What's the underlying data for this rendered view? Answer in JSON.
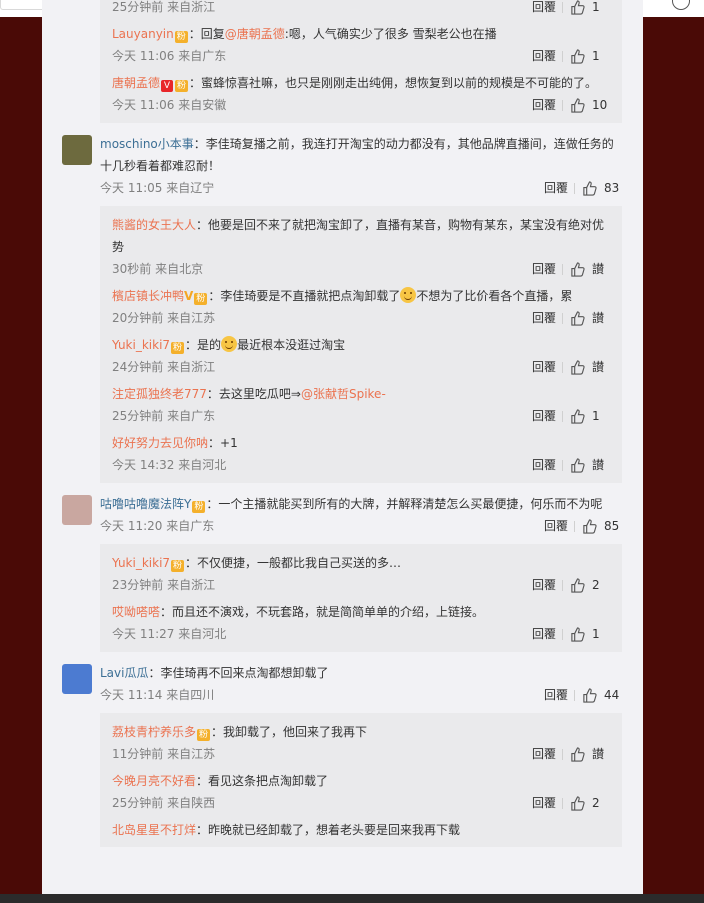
{
  "topbar": {},
  "comments": [
    {
      "user": null,
      "top_partial": true,
      "replies": [
        {
          "name": "",
          "text": "……",
          "time": "25分钟前 来自浙江",
          "reply": "回覆",
          "likes": "1",
          "partial": true
        },
        {
          "name": "Lauyanyin",
          "badge": true,
          "text_prefix": "：回复",
          "at": "@唐朝孟德",
          "text": ":嗯，人气确实少了很多 雪梨老公也在播",
          "time": "今天 11:06 来自广东",
          "reply": "回覆",
          "likes": "1"
        },
        {
          "name": "唐朝孟德",
          "vip": true,
          "badge": true,
          "text": "：蜜蜂惊喜社嘛，也只是刚刚走出纯佣，想恢复到以前的规模是不可能的了。",
          "time": "今天 11:06 来自安徽",
          "reply": "回覆",
          "likes": "10"
        }
      ]
    },
    {
      "user": "moschino小本事",
      "text": "：李佳琦复播之前，我连打开淘宝的动力都没有，其他品牌直播间，连做任务的十几秒看着都难忍耐！",
      "time": "今天 11:05 来自辽宁",
      "reply": "回覆",
      "likes": "83",
      "replies": [
        {
          "name": "熊酱的女王大人",
          "text": "：他要是回不来了就把淘宝卸了，直播有某音，购物有某东，某宝没有绝对优势",
          "time": "30秒前 来自北京",
          "reply": "回覆",
          "likes": "讃"
        },
        {
          "name": "檳店镇长冲鸭",
          "vgold": true,
          "badge": true,
          "text": "：李佳琦要是不直播就把点淘卸载了",
          "emoji": true,
          "text2": "不想为了比价看各个直播，累",
          "time": "20分钟前 来自江苏",
          "reply": "回覆",
          "likes": "讃"
        },
        {
          "name": "Yuki_kiki7",
          "badge": true,
          "text": "：是的",
          "emoji": true,
          "text2": "最近根本没逛过淘宝",
          "time": "24分钟前 来自浙江",
          "reply": "回覆",
          "likes": "讃"
        },
        {
          "name": "注定孤独终老777",
          "text": "：去这里吃瓜吧⇒",
          "at": "@张献哲Spike-",
          "time": "25分钟前 来自广东",
          "reply": "回覆",
          "likes": "1"
        },
        {
          "name": "好好努力去见你呐",
          "text": "：+1",
          "time": "今天 14:32 来自河北",
          "reply": "回覆",
          "likes": "讃"
        }
      ]
    },
    {
      "user": "咕噜咕噜魔法阵Y",
      "badge": true,
      "text": "：一个主播就能买到所有的大牌，并解释清楚怎么买最便捷，何乐而不为呢",
      "time": "今天 11:20 来自广东",
      "reply": "回覆",
      "likes": "85",
      "replies": [
        {
          "name": "Yuki_kiki7",
          "badge": true,
          "text": "：不仅便捷，一般都比我自己买送的多…",
          "time": "23分钟前 来自浙江",
          "reply": "回覆",
          "likes": "2"
        },
        {
          "name": "哎呦嗒嗒",
          "text": "：而且还不演戏，不玩套路，就是简简单单的介绍，上链接。",
          "time": "今天 11:27 来自河北",
          "reply": "回覆",
          "likes": "1"
        }
      ]
    },
    {
      "user": "Lavi瓜瓜",
      "text": "：李佳琦再不回来点淘都想卸载了",
      "time": "今天 11:14 来自四川",
      "reply": "回覆",
      "likes": "44",
      "replies": [
        {
          "name": "荔枝青柠养乐多",
          "badge": true,
          "text": "：我卸载了，他回来了我再下",
          "time": "11分钟前 来自江苏",
          "reply": "回覆",
          "likes": "讃"
        },
        {
          "name": "今晚月亮不好看",
          "text": "：看见这条把点淘卸载了",
          "time": "25分钟前 来自陕西",
          "reply": "回覆",
          "likes": "2"
        },
        {
          "name": "北岛星星不打烊",
          "text": "：昨晚就已经卸载了，想着老头要是回来我再下载",
          "time": "",
          "reply": "",
          "likes": ""
        }
      ]
    }
  ]
}
